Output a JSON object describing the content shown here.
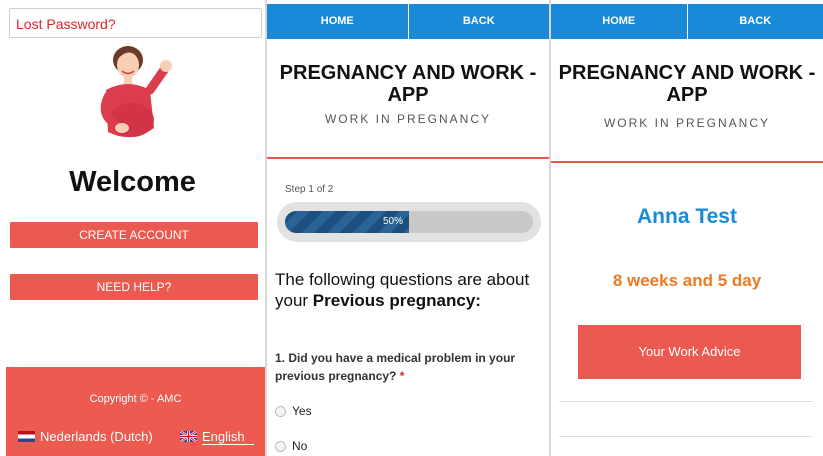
{
  "panel1": {
    "lost_password": "Lost Password?",
    "welcome": "Welcome",
    "create_account": "CREATE ACCOUNT",
    "need_help": "NEED HELP?",
    "copyright": "Copyright © - AMC",
    "lang_nl": "Nederlands (Dutch)",
    "lang_en": "English"
  },
  "nav": {
    "home": "HOME",
    "back": "BACK"
  },
  "app": {
    "title": "PREGNANCY AND WORK - APP",
    "subtitle": "WORK IN PREGNANCY"
  },
  "panel2": {
    "step": "Step 1 of 2",
    "progress_percent": 50,
    "progress_label": "50%",
    "intro_text": "The following questions are about your ",
    "intro_bold": "Previous pregnancy:",
    "question": "1. Did you have a medical problem in your previous pregnancy?",
    "required_mark": "*",
    "options": [
      "Yes",
      "No"
    ]
  },
  "panel3": {
    "user_name": "Anna Test",
    "duration": "8 weeks and 5 day",
    "advice_button": "Your Work Advice"
  },
  "colors": {
    "accent_red": "#ea5a50",
    "nav_blue": "#1a8ad8",
    "orange": "#f07a22"
  }
}
